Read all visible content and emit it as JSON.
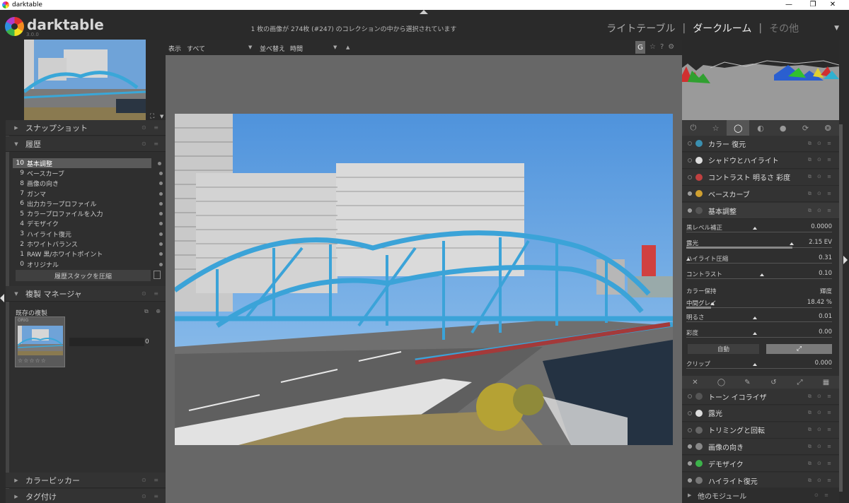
{
  "window": {
    "title": "darktable",
    "controls": {
      "minimize": "—",
      "maximize": "❐",
      "close": "✕"
    }
  },
  "header": {
    "logo_text": "darktable",
    "version": "3.0.0",
    "status": "1 枚の画像が 274枚 (#247) のコレクションの中から選択されています",
    "views": {
      "lighttable": "ライトテーブル",
      "separator": "|",
      "darkroom": "ダークルーム",
      "other": "その他",
      "dropdown": "▼"
    }
  },
  "left_panel": {
    "snapshots": {
      "label": "スナップショット"
    },
    "history": {
      "label": "履歴",
      "items": [
        {
          "num": "10",
          "label": "基本調整",
          "selected": true
        },
        {
          "num": "9",
          "label": "ベースカーブ"
        },
        {
          "num": "8",
          "label": "画像の向き"
        },
        {
          "num": "7",
          "label": "ガンマ"
        },
        {
          "num": "6",
          "label": "出力カラープロファイル"
        },
        {
          "num": "5",
          "label": "カラープロファイルを入力"
        },
        {
          "num": "4",
          "label": "デモザイク"
        },
        {
          "num": "3",
          "label": "ハイライト復元"
        },
        {
          "num": "2",
          "label": "ホワイトバランス"
        },
        {
          "num": "1",
          "label": "RAW 黒/ホワイトポイント"
        },
        {
          "num": "0",
          "label": "オリジナル"
        }
      ],
      "compress_button": "履歴スタックを圧縮"
    },
    "duplicate_manager": {
      "label": "複製 マネージャ",
      "existing_label": "既存の複製",
      "version_tag": "ORIG",
      "stars": "☆☆☆☆☆",
      "value": "0"
    },
    "color_picker": {
      "label": "カラーピッカー"
    },
    "tagging": {
      "label": "タグ付け"
    }
  },
  "center": {
    "toolbar": {
      "display_label": "表示",
      "display_value": "すべて",
      "sort_label": "並べ替え",
      "sort_value": "時間",
      "sort_dir": "▲",
      "g_button": "G",
      "star_icon": "☆",
      "help_icon": "?",
      "gear_icon": "⚙"
    }
  },
  "right_panel": {
    "module_groups": [
      "⏻",
      "☆",
      "◯",
      "◐",
      "●",
      "⟳",
      "❂"
    ],
    "modules_top": [
      {
        "label": "カラー 復元",
        "icon": "color-restore-icon",
        "on": false
      },
      {
        "label": "シャドウとハイライト",
        "icon": "shadows-icon",
        "on": false
      },
      {
        "label": "コントラスト 明るさ 彩度",
        "icon": "contrast-icon",
        "on": false
      },
      {
        "label": "ベースカーブ",
        "icon": "basecurve-icon",
        "on": true
      },
      {
        "label": "基本調整",
        "icon": "basic-adjust-icon",
        "on": true
      }
    ],
    "basic_adjustments": {
      "params": [
        {
          "label": "黒レベル補正",
          "value": "0.0000",
          "pos": 0.47
        },
        {
          "label": "露光",
          "value": "2.15 EV",
          "pos": 0.73,
          "fill": true
        },
        {
          "label": "ハイライト圧縮",
          "value": "0.31",
          "pos": 0.0
        },
        {
          "label": "コントラスト",
          "value": "0.10",
          "pos": 0.52
        },
        {
          "label": "中間グレイ",
          "value": "18.42 %",
          "pos": 0.17,
          "fill": true
        },
        {
          "label": "明るさ",
          "value": "0.01",
          "pos": 0.47
        },
        {
          "label": "彩度",
          "value": "0.00",
          "pos": 0.47
        },
        {
          "label": "クリップ",
          "value": "0.000",
          "pos": 0.47
        }
      ],
      "preserve_label": "カラー保持",
      "preserve_value": "輝度",
      "auto_button": "自動",
      "picker_button": "⤢"
    },
    "blend_tabs": [
      "✕",
      "◯",
      "✎",
      "↺",
      "⤢",
      "▦"
    ],
    "modules_bottom": [
      {
        "label": "トーン イコライザ",
        "icon": "tone-eq-icon",
        "on": false
      },
      {
        "label": "露光",
        "icon": "exposure-icon",
        "on": false
      },
      {
        "label": "トリミングと回転",
        "icon": "crop-icon",
        "on": false
      },
      {
        "label": "画像の向き",
        "icon": "orientation-icon",
        "on": true
      },
      {
        "label": "デモザイク",
        "icon": "demosaic-icon",
        "on": true
      },
      {
        "label": "ハイライト復元",
        "icon": "highlight-icon",
        "on": true
      }
    ],
    "other_modules": "他のモジュール"
  }
}
